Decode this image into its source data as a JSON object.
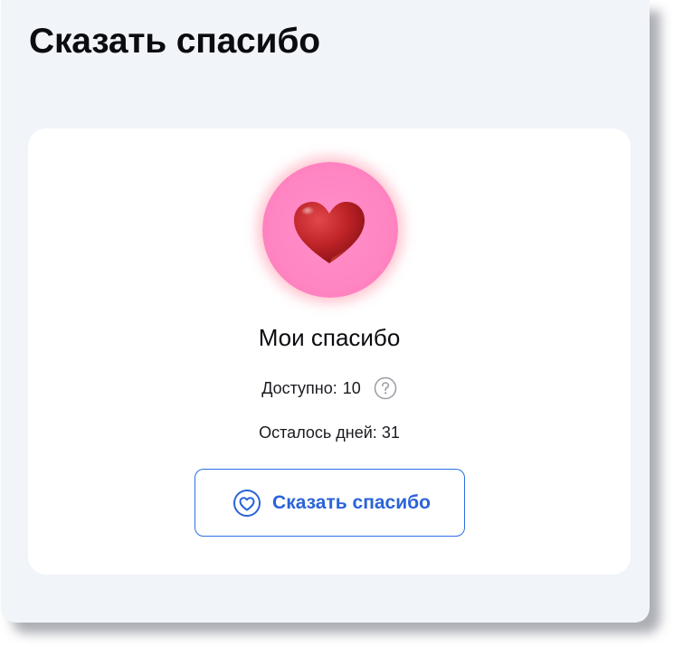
{
  "page": {
    "title": "Сказать спасибо"
  },
  "card": {
    "avatar_icon": "heart-icon",
    "title": "Мои спасибо",
    "available_label": "Доступно:",
    "available_value": "10",
    "help_icon": "question-icon",
    "days_label": "Осталось дней:",
    "days_value": "31",
    "button_label": "Сказать спасибо",
    "button_icon": "heart-outline-icon"
  },
  "colors": {
    "panel_background": "#f1f4f9",
    "card_background": "#ffffff",
    "accent": "#2b6fe6",
    "avatar_background": "#ff86c4",
    "heart": "#c8262b"
  }
}
